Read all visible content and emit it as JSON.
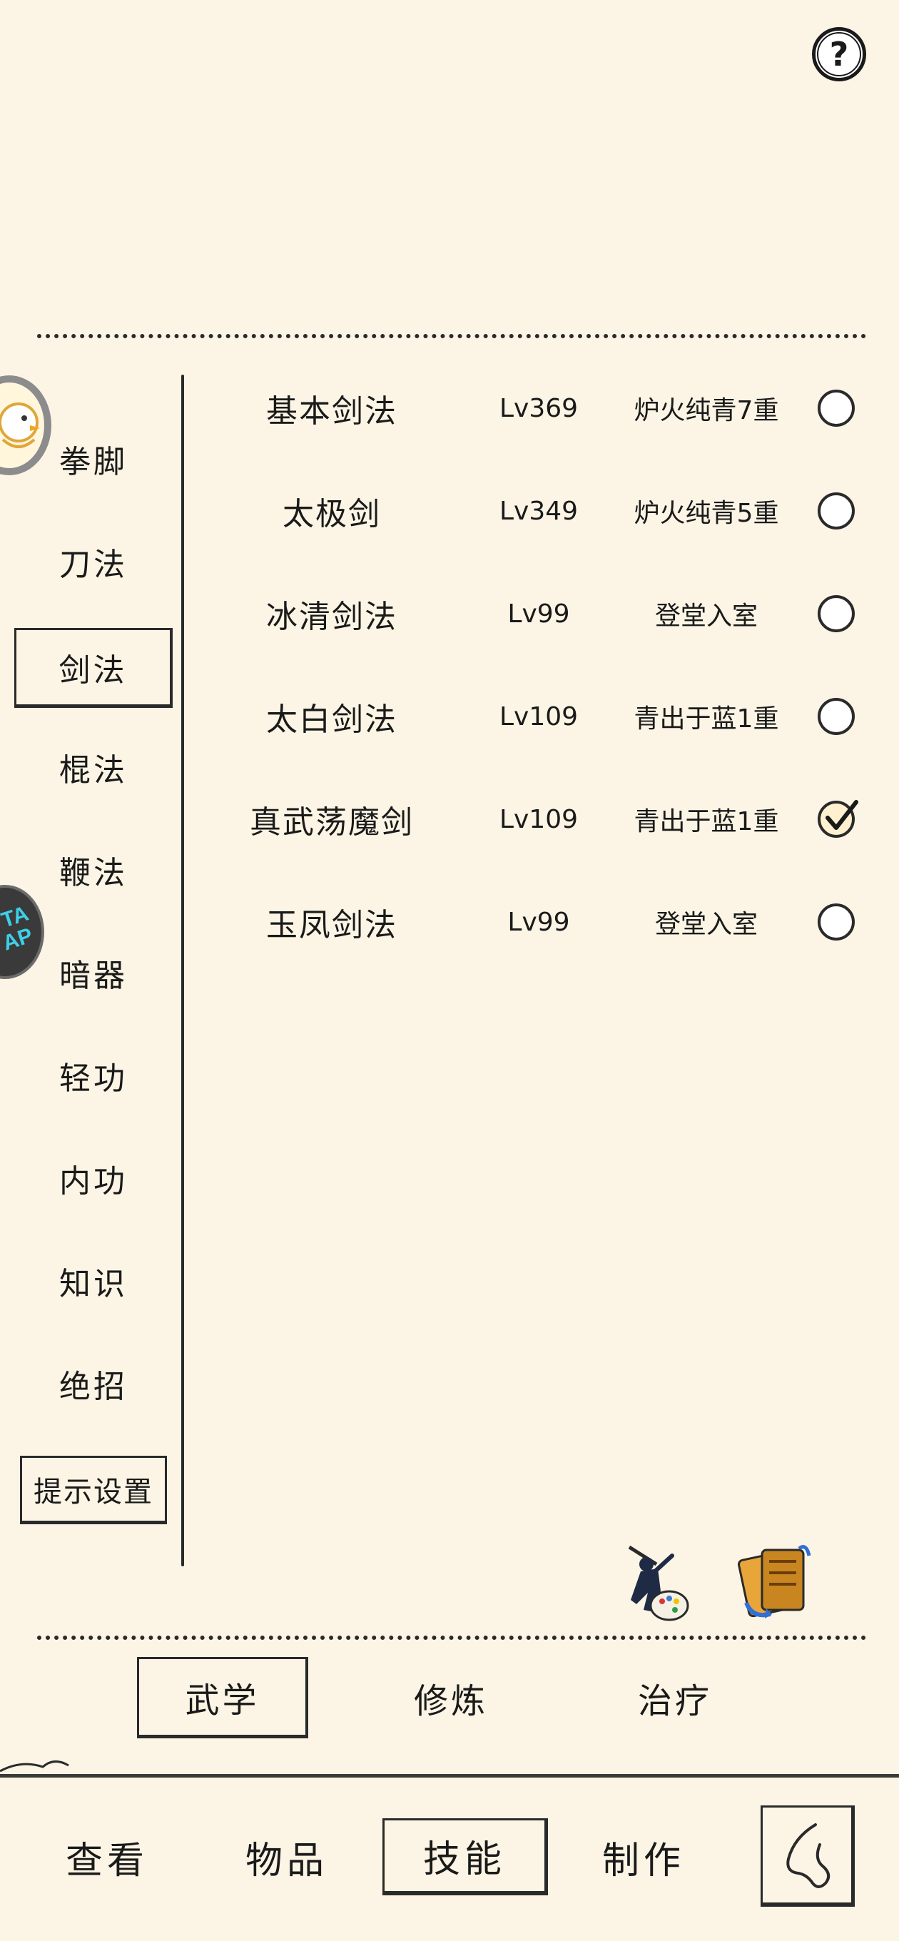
{
  "header": {
    "help_label": "?"
  },
  "categories": [
    {
      "label": "拳脚",
      "selected": false
    },
    {
      "label": "刀法",
      "selected": false
    },
    {
      "label": "剑法",
      "selected": true
    },
    {
      "label": "棍法",
      "selected": false
    },
    {
      "label": "鞭法",
      "selected": false
    },
    {
      "label": "暗器",
      "selected": false
    },
    {
      "label": "轻功",
      "selected": false
    },
    {
      "label": "内功",
      "selected": false
    },
    {
      "label": "知识",
      "selected": false
    },
    {
      "label": "绝招",
      "selected": false
    }
  ],
  "tip_settings_label": "提示设置",
  "skills": [
    {
      "name": "基本剑法",
      "level": "Lv369",
      "rank": "炉火纯青7重",
      "checked": false
    },
    {
      "name": "太极剑",
      "level": "Lv349",
      "rank": "炉火纯青5重",
      "checked": false
    },
    {
      "name": "冰清剑法",
      "level": "Lv99",
      "rank": "登堂入室",
      "checked": false
    },
    {
      "name": "太白剑法",
      "level": "Lv109",
      "rank": "青出于蓝1重",
      "checked": false
    },
    {
      "name": "真武荡魔剑",
      "level": "Lv109",
      "rank": "青出于蓝1重",
      "checked": true
    },
    {
      "name": "玉凤剑法",
      "level": "Lv99",
      "rank": "登堂入室",
      "checked": false
    }
  ],
  "action_icons": [
    "swordsman-palette-icon",
    "scroll-swap-icon"
  ],
  "sub_tabs": [
    {
      "label": "武学",
      "selected": true
    },
    {
      "label": "修炼",
      "selected": false
    },
    {
      "label": "治疗",
      "selected": false
    }
  ],
  "bottom_nav": [
    {
      "label": "查看",
      "selected": false
    },
    {
      "label": "物品",
      "selected": false
    },
    {
      "label": "技能",
      "selected": true
    },
    {
      "label": "制作",
      "selected": false
    }
  ],
  "colors": {
    "background": "#fcf5e5",
    "ink": "#1a1a1a",
    "check_fill": "#fff1cf"
  }
}
